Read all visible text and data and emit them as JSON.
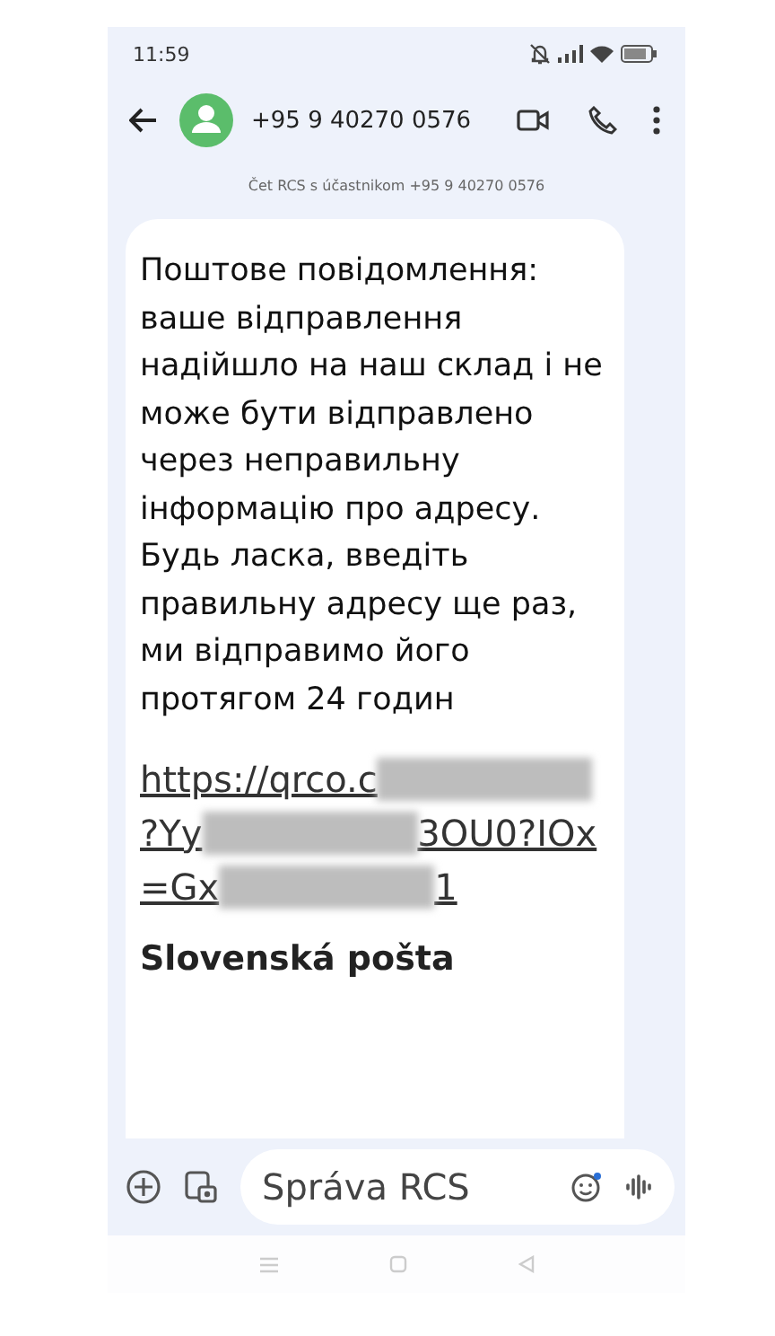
{
  "status_bar": {
    "time": "11:59"
  },
  "header": {
    "contact": "+95 9 40270 0576"
  },
  "chat_info": "Čet RCS s účastnikom +95 9 40270 0576",
  "message": {
    "text": "Поштове повідомлення: ваше відправлення надійшло на наш склад і не може бути відправлено через неправильну інформацію про адресу. Будь ласка, введіть правильну адресу ще раз, ми відправимо його протягом 24 годин",
    "link_lines": [
      [
        {
          "kind": "text",
          "text": "https://qrco.c"
        },
        {
          "kind": "redacted"
        }
      ],
      [
        {
          "kind": "text",
          "text": "?Yy"
        },
        {
          "kind": "redacted"
        },
        {
          "kind": "text",
          "text": "3OU0?IOx"
        }
      ],
      [
        {
          "kind": "text",
          "text": "=Gx"
        },
        {
          "kind": "redacted"
        },
        {
          "kind": "text",
          "text": "1"
        }
      ]
    ],
    "sender": "Slovenská pošta"
  },
  "composer": {
    "placeholder": "Správa RCS"
  }
}
